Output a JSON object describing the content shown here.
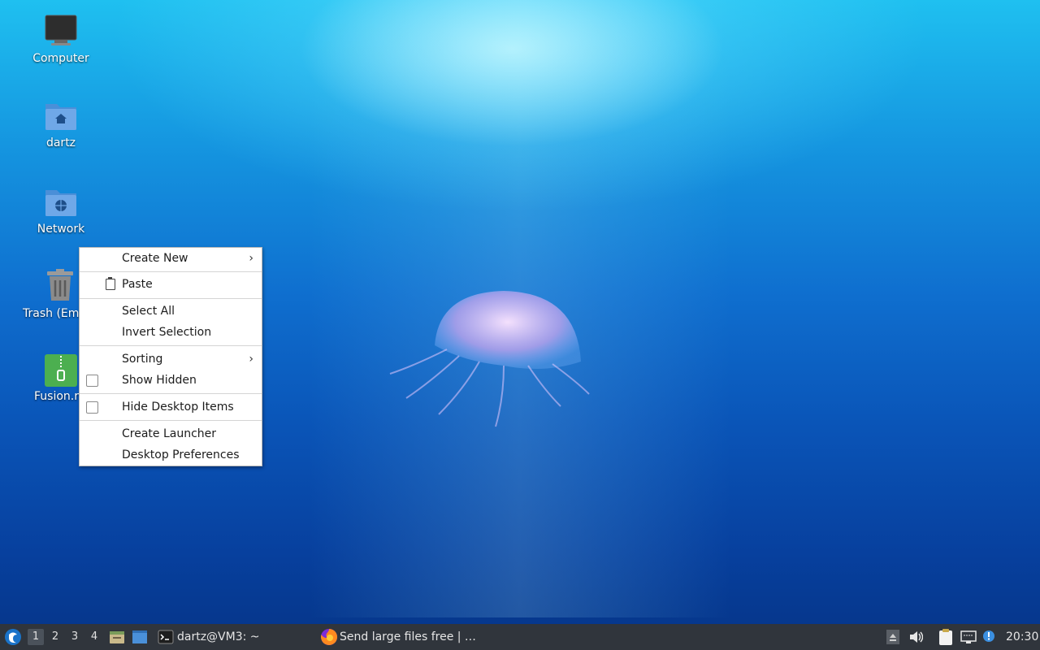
{
  "desktop": {
    "icons": [
      {
        "label": "Computer"
      },
      {
        "label": "dartz"
      },
      {
        "label": "Network"
      },
      {
        "label": "Trash (Emp"
      },
      {
        "label": "Fusion.r"
      }
    ]
  },
  "context_menu": {
    "create_new": "Create New",
    "paste": "Paste",
    "select_all": "Select All",
    "invert_selection": "Invert Selection",
    "sorting": "Sorting",
    "show_hidden": "Show Hidden",
    "hide_desktop_items": "Hide Desktop Items",
    "create_launcher": "Create Launcher",
    "desktop_preferences": "Desktop Preferences",
    "submenu_arrow": "›"
  },
  "taskbar": {
    "workspaces": [
      "1",
      "2",
      "3",
      "4"
    ],
    "active_workspace": "1",
    "tasks": [
      {
        "label": "dartz@VM3: ~",
        "icon": "terminal-icon"
      },
      {
        "label": "Send large files free | …",
        "icon": "firefox-icon"
      }
    ],
    "clock": "20:30"
  },
  "colors": {
    "taskbar_bg": "#30353c",
    "menu_bg": "#ffffff",
    "accent": "#1596e0"
  }
}
